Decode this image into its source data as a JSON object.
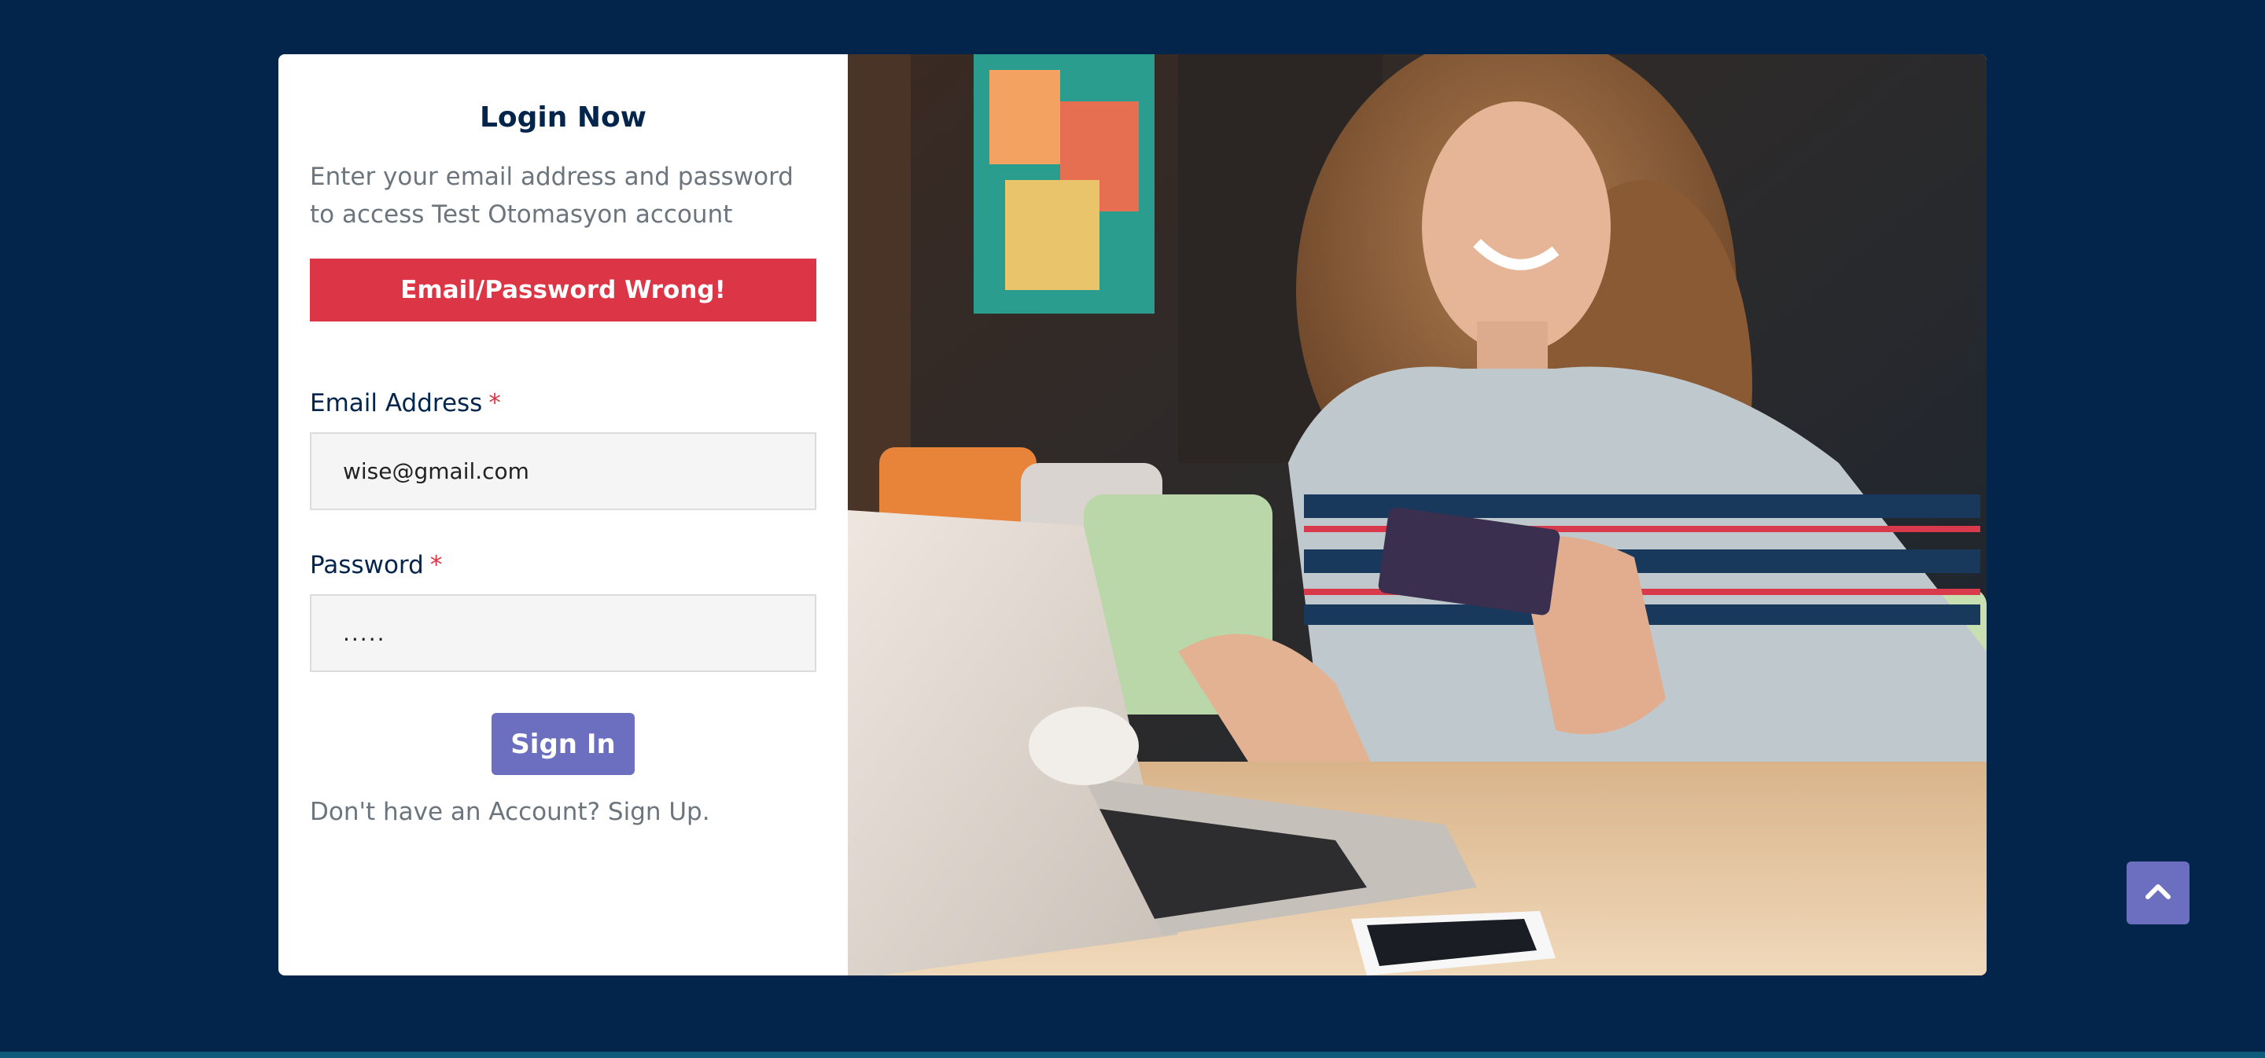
{
  "login": {
    "title": "Login Now",
    "subtitle": "Enter your email address and password to access Test Otomasyon account",
    "alert": "Email/Password Wrong!",
    "email_label": "Email Address",
    "password_label": "Password",
    "required_marker": "*",
    "email_value": "wise@gmail.com",
    "password_value": ".....",
    "signin_label": "Sign In",
    "signup_text": "Don't have an Account? Sign Up."
  },
  "icons": {
    "scroll_top": "chevron-up-icon"
  },
  "colors": {
    "page_bg": "#03254c",
    "card_bg": "#ffffff",
    "alert_bg": "#dc3545",
    "button_bg": "#6c6fbf",
    "heading": "#03254c",
    "muted_text": "#6c757d",
    "required": "#dc3545"
  }
}
